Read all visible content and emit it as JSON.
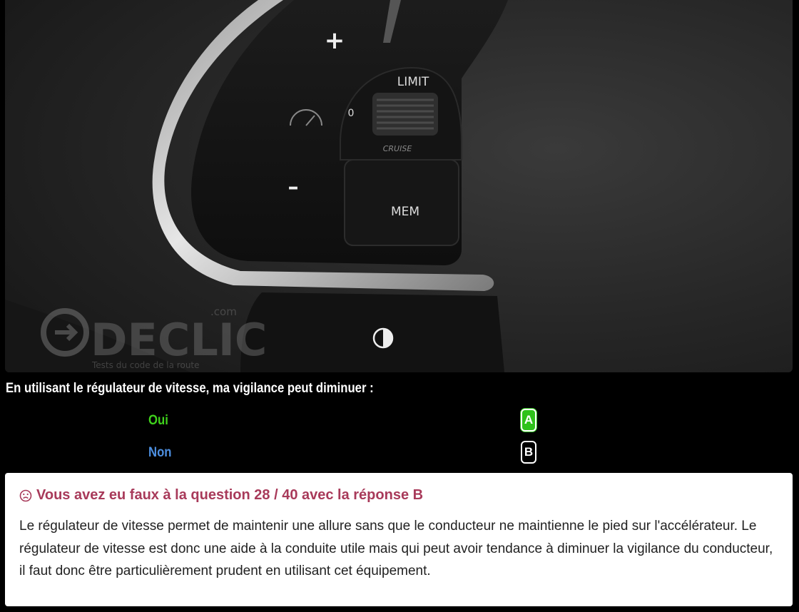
{
  "image": {
    "watermark_brand": "DECLIC",
    "watermark_suffix": ".com",
    "watermark_tagline": "Tests du code de la route",
    "button_labels": {
      "plus": "+",
      "minus": "–",
      "limit": "LIMIT",
      "zero": "0",
      "cruise": "CRUISE",
      "mem": "MEM"
    }
  },
  "question": {
    "text": "En utilisant le régulateur de vitesse, ma vigilance peut diminuer :"
  },
  "answers": [
    {
      "label": "Oui",
      "key": "A",
      "state": "correct"
    },
    {
      "label": "Non",
      "key": "B",
      "state": "selected-wrong"
    }
  ],
  "result": {
    "icon": "sad-face-icon",
    "title": "Vous avez eu faux à la question 28 / 40 avec la réponse B",
    "explanation": "Le régulateur de vitesse permet de maintenir une allure sans que le conducteur ne maintienne le pied sur l'accélérateur. Le régulateur de vitesse est donc une aide à la conduite utile mais qui peut avoir tendance à diminuer la vigilance du conducteur, il faut donc être particulièrement prudent en utilisant cet équipement."
  },
  "colors": {
    "correct": "#2ec21a",
    "oui_text": "#3fd21c",
    "non_text": "#4d8fe0",
    "error_title": "#a83a5a"
  }
}
